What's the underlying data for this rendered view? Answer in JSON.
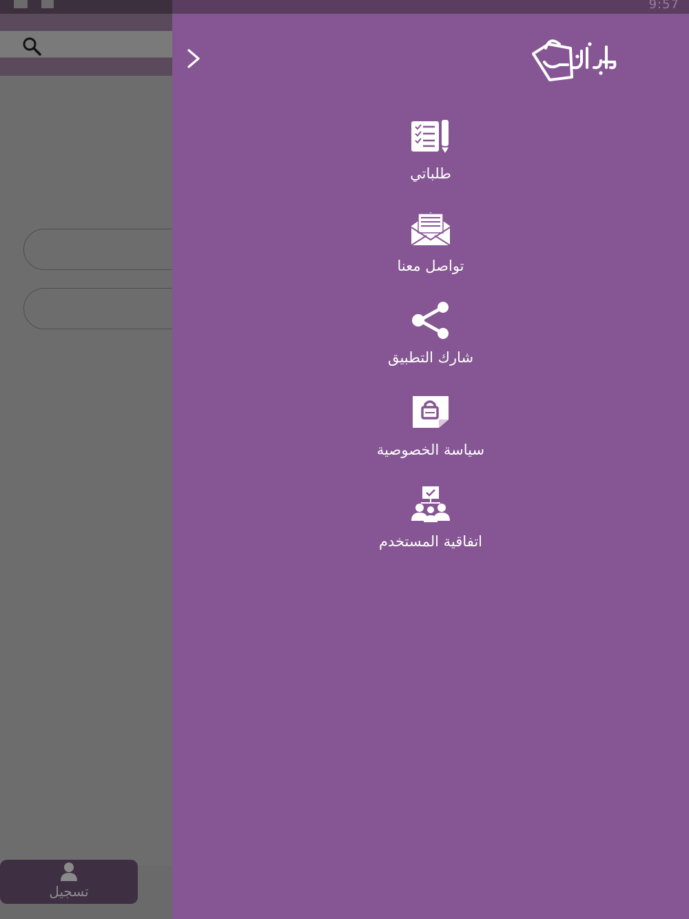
{
  "status_bar": {
    "time": "9:57"
  },
  "background_app": {
    "search_icon": "search-icon",
    "register_button_label": "تسجيل",
    "register_icon": "user-icon"
  },
  "drawer": {
    "close_icon": "chevron-right-icon",
    "logo_text": "بازارعدن",
    "menu": [
      {
        "label": "طلباتي",
        "icon": "orders-list-icon"
      },
      {
        "label": "تواصل معنا",
        "icon": "envelope-icon"
      },
      {
        "label": "شارك التطبيق",
        "icon": "share-icon"
      },
      {
        "label": "سياسة الخصوصية",
        "icon": "privacy-lock-icon"
      },
      {
        "label": "اتفاقية المستخدم",
        "icon": "user-agreement-icon"
      }
    ]
  },
  "colors": {
    "drawer_background": "#855693",
    "text": "#ffffff",
    "dim_overlay": "#6f6f6f",
    "register_button": "#3e2f43"
  }
}
